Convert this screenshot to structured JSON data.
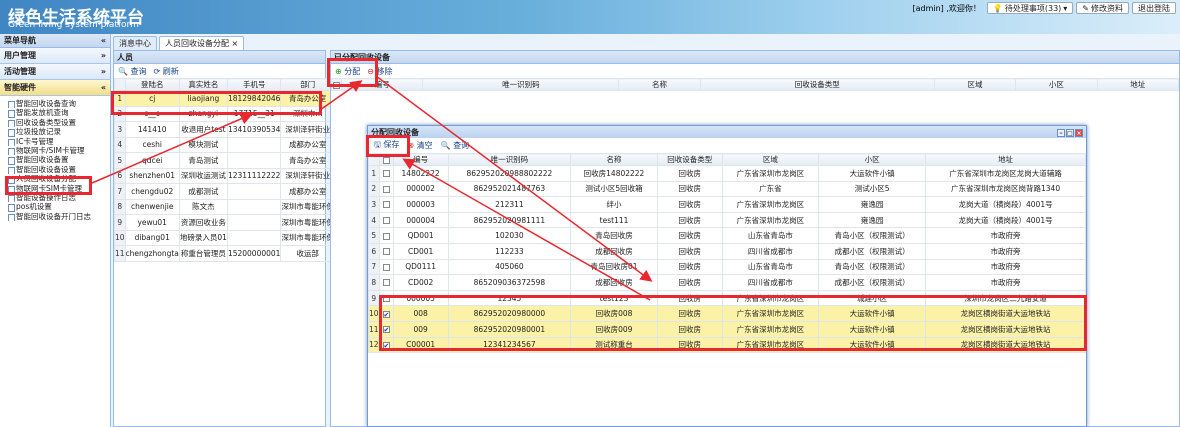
{
  "header": {
    "logo_cn": "绿色生活系统平台",
    "logo_en": "Green living system platform",
    "welcome": "[admin] ,欢迎你！",
    "btn_pending": "待处理事项(33)",
    "btn_edit": "修改资料",
    "btn_logout": "退出登陆"
  },
  "menu": {
    "title": "菜单导航",
    "groups": [
      {
        "label": "用户管理"
      },
      {
        "label": "活动管理"
      },
      {
        "label": "智能硬件"
      }
    ],
    "items": [
      "智能回收设备查询",
      "智能发放机查询",
      "回收设备类型设置",
      "垃圾投放记录",
      "IC卡号管理",
      "物联网卡/SIM卡管理",
      "智能回收设备置",
      "智能回收设备设置",
      "人员回收设备分配",
      "物联网卡SIM卡管理",
      "智能设备操作日志",
      "pos机设置",
      "智能回收设备开门日志"
    ]
  },
  "tabs": [
    "消息中心",
    "人员回收设备分配"
  ],
  "left": {
    "title": "人员",
    "search": "查询",
    "refresh": "刷新",
    "headers": [
      "登陆名",
      "真实姓名",
      "手机号",
      "部门"
    ],
    "rows": [
      [
        "cj",
        "liaojiang",
        "18129842046",
        "青岛办公室"
      ],
      [
        "c__o",
        "zhangyi",
        "17715__31",
        "深圳市..."
      ],
      [
        "141410",
        "收退用户test",
        "13410390534",
        "深圳泽轩街业"
      ],
      [
        "ceshi",
        "模块测试",
        "",
        "成都办公室"
      ],
      [
        "qdcei",
        "青岛测试",
        "",
        "青岛办公室"
      ],
      [
        "shenzhen01",
        "深圳收运测试",
        "12311112222",
        "深圳泽轩街业"
      ],
      [
        "chengdu02",
        "成都测试",
        "",
        "成都办公室"
      ],
      [
        "chenwenjie",
        "陈文杰",
        "",
        "深圳市粤能环保"
      ],
      [
        "yewu01",
        "资源回收业务",
        "",
        "深圳市粤能环保"
      ],
      [
        "dibang01",
        "地磅录入员01",
        "",
        "深圳市粤能环保"
      ],
      [
        "chengzhongta",
        "称重台管理员",
        "15200000001",
        "收运部"
      ]
    ]
  },
  "right": {
    "title": "已分配回收设备",
    "assign": "分配",
    "remove": "移除",
    "headers": [
      "编号",
      "唯一识别码",
      "名称",
      "回收设备类型",
      "区域",
      "小区",
      "地址"
    ]
  },
  "dialog": {
    "title": "分配回收设备",
    "save": "保存",
    "clear": "清空",
    "search": "查询",
    "headers": [
      "编号",
      "唯一识别码",
      "名称",
      "回收设备类型",
      "区域",
      "小区",
      "地址"
    ],
    "rows": [
      [
        "14802222",
        "862952020988802222",
        "回收房14802222",
        "回收房",
        "广东省深圳市龙岗区",
        "大运软件小镇",
        "广东省深圳市龙岗区龙岗大道辅路"
      ],
      [
        "000002",
        "862952021487763",
        "测试小区5回收箱",
        "回收房",
        "广东省",
        "测试小区5",
        "广东省深圳市龙岗区岗背路1340"
      ],
      [
        "000003",
        "212311",
        "绊小",
        "回收房",
        "广东省深圳市龙岗区",
        "雍逸园",
        "龙岗大道（横岗段）4001号"
      ],
      [
        "000004",
        "862952020981111",
        "test111",
        "回收房",
        "广东省深圳市龙岗区",
        "雍逸园",
        "龙岗大道（横岗段）4001号"
      ],
      [
        "QD001",
        "102030",
        "青岛回收房",
        "回收房",
        "山东省青岛市",
        "青岛小区（权限测试）",
        "市政府旁"
      ],
      [
        "CD001",
        "112233",
        "成都回收房",
        "回收房",
        "四川省成都市",
        "成都小区（权限测试）",
        "市政府旁"
      ],
      [
        "QD0111",
        "405060",
        "青岛回收房01",
        "回收房",
        "山东省青岛市",
        "青岛小区（权限测试）",
        "市政府旁"
      ],
      [
        "CD002",
        "865209036372598",
        "成都回收房",
        "回收房",
        "四川省成都市",
        "成都小区（权限测试）",
        "市政府旁"
      ],
      [
        "000005",
        "12345",
        "test123",
        "回收房",
        "广东省深圳市龙岗区",
        "城建小区",
        "深圳市龙岗区二九路安道"
      ],
      [
        "008",
        "862952020980000",
        "回收房008",
        "回收房",
        "广东省深圳市龙岗区",
        "大运软件小镇",
        "龙岗区横岗街道大运地铁站"
      ],
      [
        "009",
        "862952020980001",
        "回收房009",
        "回收房",
        "广东省深圳市龙岗区",
        "大运软件小镇",
        "龙岗区横岗街道大运地铁站"
      ],
      [
        "C00001",
        "12341234567",
        "测试称重台",
        "回收房",
        "广东省深圳市龙岗区",
        "大运软件小镇",
        "龙岗区横岗街道大运地铁站"
      ]
    ],
    "checked": [
      9,
      10,
      11
    ]
  },
  "colors": {
    "highlight": "#e8282e",
    "selected": "#fbf2a8"
  }
}
